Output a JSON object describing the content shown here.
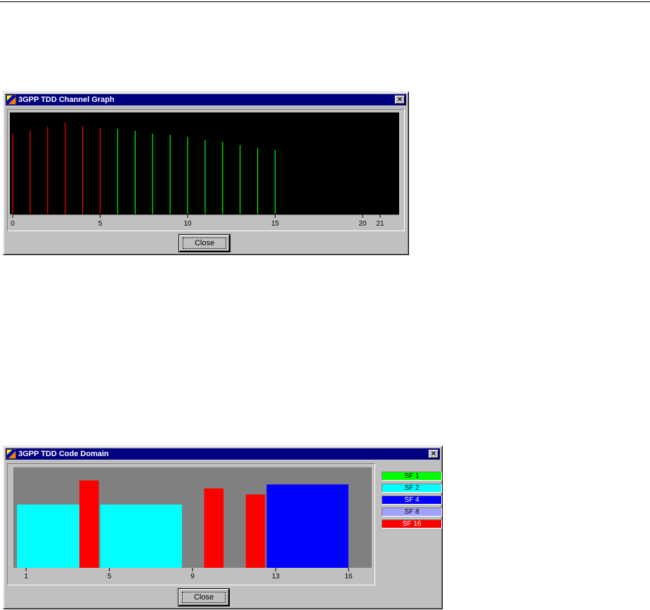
{
  "channel_window": {
    "title": "3GPP TDD Channel Graph",
    "close_button_label": "Close",
    "close_glyph": "×"
  },
  "code_window": {
    "title": "3GPP TDD Code Domain",
    "close_button_label": "Close",
    "close_glyph": "×",
    "legend": [
      {
        "label": "SF 1",
        "color": "#00ff00"
      },
      {
        "label": "SF 2",
        "color": "#00ffff"
      },
      {
        "label": "SF 4",
        "color": "#0000ff"
      },
      {
        "label": "SF 8",
        "color": "#a0a0ff"
      },
      {
        "label": "SF 16",
        "color": "#ff0000"
      }
    ]
  },
  "chart_data": [
    {
      "type": "bar",
      "title": "3GPP TDD Channel Graph",
      "background": "#000000",
      "xlim": [
        0,
        22
      ],
      "ylim": [
        0,
        1
      ],
      "x_ticks": [
        0,
        5,
        10,
        15,
        20,
        21
      ],
      "bars": [
        {
          "x": 0,
          "value": 0.79,
          "color": "#ff0000"
        },
        {
          "x": 1,
          "value": 0.82,
          "color": "#ff0000"
        },
        {
          "x": 2,
          "value": 0.86,
          "color": "#ff0000"
        },
        {
          "x": 3,
          "value": 0.9,
          "color": "#ff0000"
        },
        {
          "x": 4,
          "value": 0.87,
          "color": "#ff0000"
        },
        {
          "x": 5,
          "value": 0.85,
          "color": "#ff0000"
        },
        {
          "x": 6,
          "value": 0.84,
          "color": "#00ff00"
        },
        {
          "x": 7,
          "value": 0.82,
          "color": "#00ff00"
        },
        {
          "x": 8,
          "value": 0.79,
          "color": "#00ff00"
        },
        {
          "x": 9,
          "value": 0.78,
          "color": "#00ff00"
        },
        {
          "x": 10,
          "value": 0.76,
          "color": "#00ff00"
        },
        {
          "x": 11,
          "value": 0.73,
          "color": "#00ff00"
        },
        {
          "x": 12,
          "value": 0.71,
          "color": "#00ff00"
        },
        {
          "x": 13,
          "value": 0.68,
          "color": "#00ff00"
        },
        {
          "x": 14,
          "value": 0.65,
          "color": "#00ff00"
        },
        {
          "x": 15,
          "value": 0.63,
          "color": "#00ff00"
        }
      ]
    },
    {
      "type": "bar",
      "title": "3GPP TDD Code Domain",
      "background": "#808080",
      "xlim": [
        0.5,
        16.9
      ],
      "ylim": [
        0,
        1
      ],
      "x_ticks": [
        1,
        5,
        9,
        13,
        16
      ],
      "bars": [
        {
          "code_start": 1,
          "code_end": 4,
          "value": 0.63,
          "sf": "SF 2",
          "color": "#00ffff"
        },
        {
          "code_start": 5,
          "code_end": 8,
          "value": 0.63,
          "sf": "SF 2",
          "color": "#00ffff"
        },
        {
          "code_start": 4,
          "code_end": 4,
          "value": 0.87,
          "sf": "SF 16",
          "color": "#ff0000"
        },
        {
          "code_start": 10,
          "code_end": 10,
          "value": 0.79,
          "sf": "SF 16",
          "color": "#ff0000"
        },
        {
          "code_start": 12,
          "code_end": 12,
          "value": 0.73,
          "sf": "SF 16",
          "color": "#ff0000"
        },
        {
          "code_start": 13,
          "code_end": 16,
          "value": 0.83,
          "sf": "SF 4",
          "color": "#0000ff"
        }
      ]
    }
  ]
}
